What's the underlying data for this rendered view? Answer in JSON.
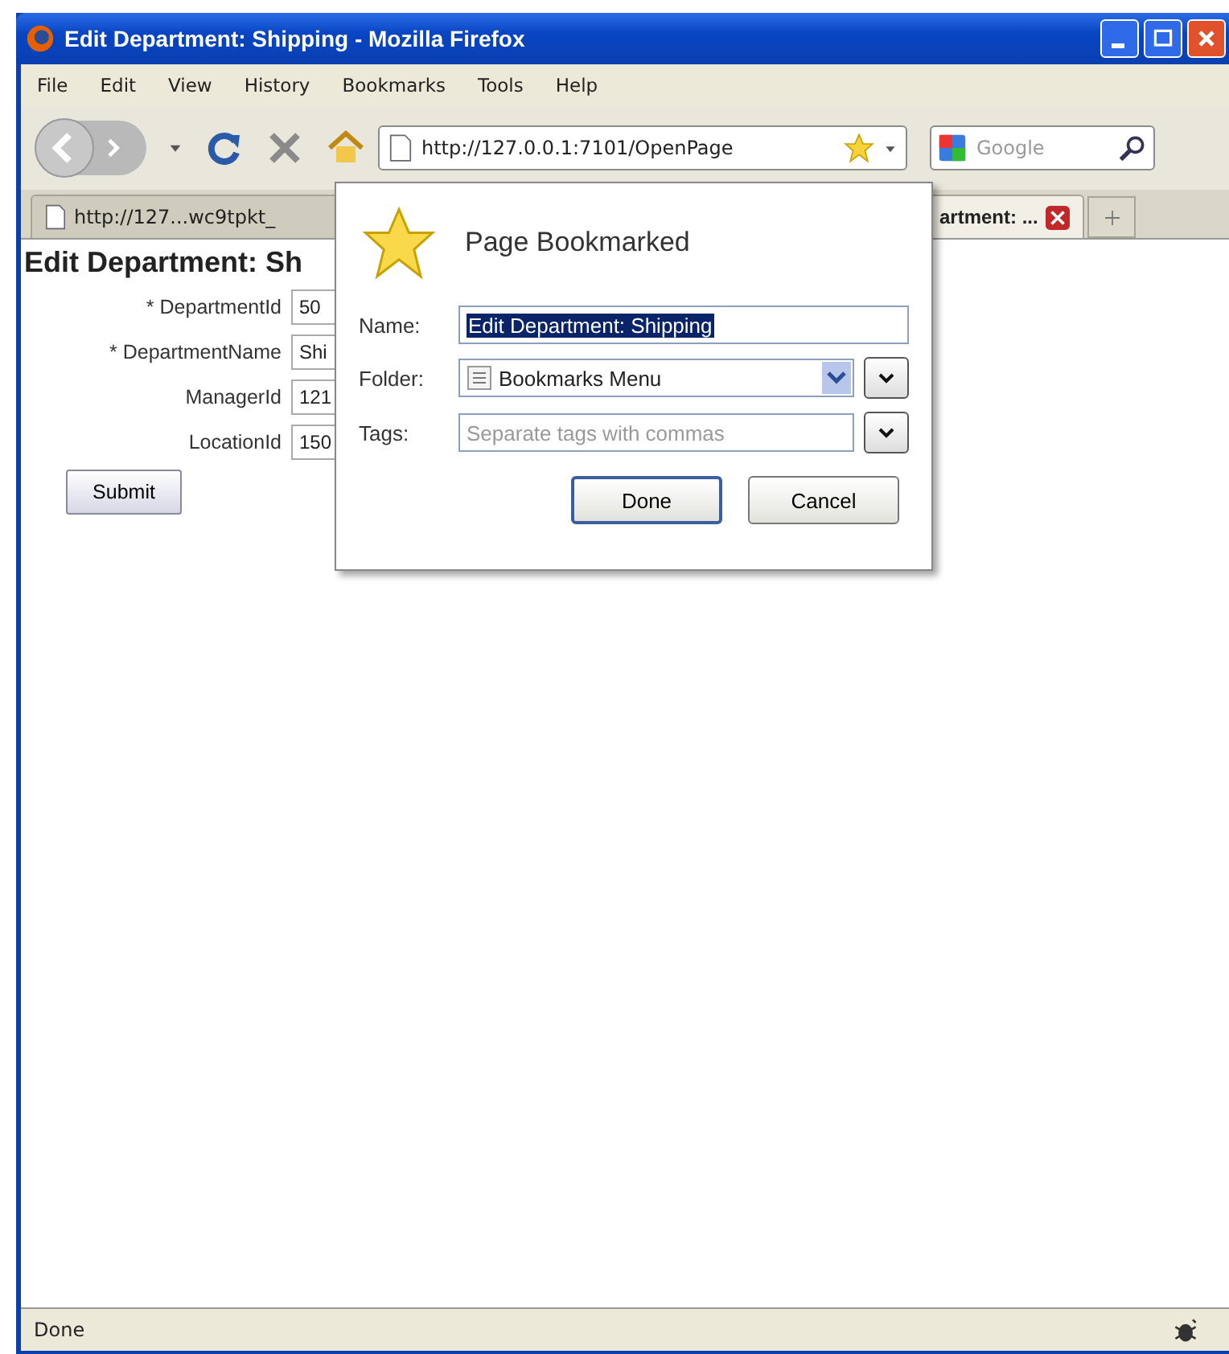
{
  "window": {
    "title": "Edit Department: Shipping - Mozilla Firefox"
  },
  "menu": [
    "File",
    "Edit",
    "View",
    "History",
    "Bookmarks",
    "Tools",
    "Help"
  ],
  "toolbar": {
    "url": "http://127.0.0.1:7101/OpenPage",
    "search_placeholder": "Google"
  },
  "tabs": [
    {
      "label": "http://127...wc9tpkt_",
      "selected": false
    },
    {
      "label": "artment: ...",
      "selected": true
    }
  ],
  "page": {
    "heading": "Edit Department: Sh",
    "fields": [
      {
        "marker": "*",
        "label": "DepartmentId",
        "value": "50"
      },
      {
        "marker": "*",
        "label": "DepartmentName",
        "value": "Shi"
      },
      {
        "label": "ManagerId",
        "value": "121"
      },
      {
        "label": "LocationId",
        "value": "150"
      }
    ],
    "submit": "Submit"
  },
  "bookmark_popup": {
    "title": "Page Bookmarked",
    "name_label": "Name:",
    "name_value": "Edit Department: Shipping",
    "folder_label": "Folder:",
    "folder_value": "Bookmarks Menu",
    "tags_label": "Tags:",
    "tags_placeholder": "Separate tags with commas",
    "buttons": [
      "Done",
      "Cancel"
    ]
  },
  "status_bar": {
    "text": "Done"
  }
}
